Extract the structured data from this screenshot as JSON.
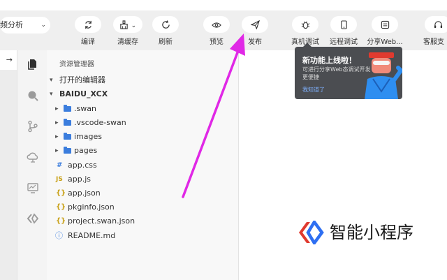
{
  "toolbar": {
    "analysis_dropdown": {
      "value": "频分析"
    },
    "buttons": [
      {
        "label": "编译"
      },
      {
        "label": "清缓存"
      },
      {
        "label": "刷新"
      },
      {
        "label": "预览"
      },
      {
        "label": "发布"
      },
      {
        "label": "真机调试"
      },
      {
        "label": "远程调试"
      },
      {
        "label": "分享Web..."
      },
      {
        "label": "客服支"
      }
    ]
  },
  "left_tab": {
    "arrow": "→"
  },
  "explorer": {
    "title": "资源管理器",
    "open_editors": "打开的编辑器",
    "project": "BAIDU_XCX",
    "items": [
      {
        "label": ".swan",
        "kind": "folder"
      },
      {
        "label": ".vscode-swan",
        "kind": "folder"
      },
      {
        "label": "images",
        "kind": "folder"
      },
      {
        "label": "pages",
        "kind": "folder"
      },
      {
        "label": "app.css",
        "kind": "css",
        "glyph": "#"
      },
      {
        "label": "app.js",
        "kind": "js",
        "glyph": "JS"
      },
      {
        "label": "app.json",
        "kind": "json",
        "glyph": "{}"
      },
      {
        "label": "pkginfo.json",
        "kind": "json",
        "glyph": "{}"
      },
      {
        "label": "project.swan.json",
        "kind": "json",
        "glyph": "{}"
      },
      {
        "label": "README.md",
        "kind": "info",
        "glyph": "ⓘ"
      }
    ]
  },
  "popup": {
    "title": "新功能上线啦！",
    "desc": "可进行分享Web态调试开发更便捷",
    "link": "我知道了"
  },
  "brand": {
    "text": "智能小程序"
  },
  "colors": {
    "accent": "#3b7ddd",
    "arrow": "#e028e6",
    "brand_red": "#e03a2f",
    "brand_blue": "#2e6ff2"
  }
}
